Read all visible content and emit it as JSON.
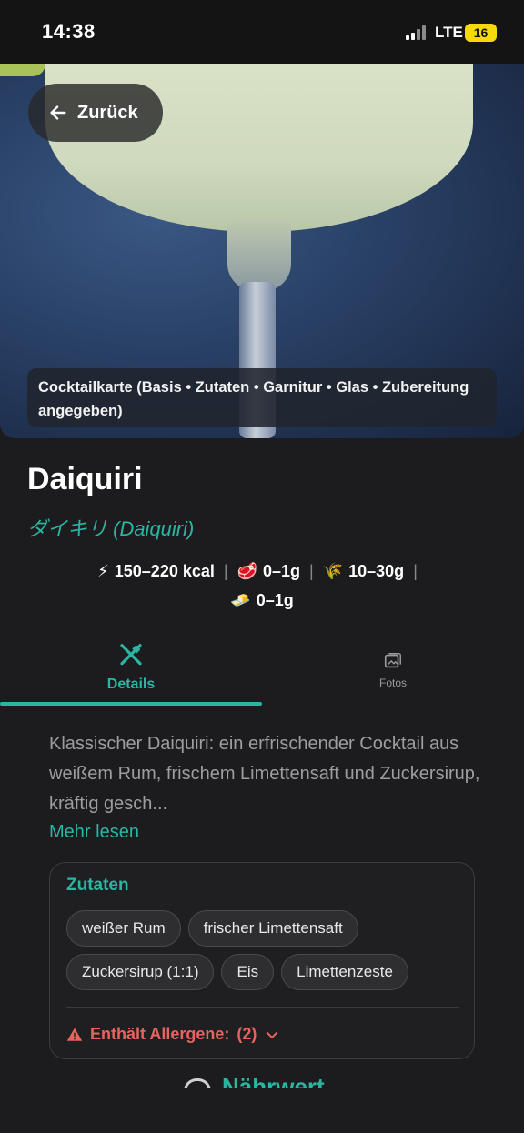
{
  "status": {
    "time": "14:38",
    "network": "LTE",
    "battery": "16"
  },
  "hero": {
    "back_label": "Zurück",
    "caption": "Cocktailkarte (Basis • Zutaten • Garnitur • Glas • Zubereitung angegeben)"
  },
  "drink": {
    "name": "Daiquiri",
    "subtitle": "ダイキリ (Daiquiri)",
    "nutrition": {
      "kcal": "150–220 kcal",
      "protein": "0–1g",
      "carbs": "10–30g",
      "fat": "0–1g"
    }
  },
  "tabs": [
    {
      "label": "Details",
      "icon": "utensils-icon",
      "active": true
    },
    {
      "label": "Fotos",
      "icon": "photo-gallery-icon",
      "active": false
    }
  ],
  "description": "Klassischer Daiquiri: ein erfrischender Cocktail aus weißem Rum, frischem Limettensaft und Zuckersirup, kräftig gesch...",
  "more_label": "Mehr lesen",
  "ingredients": {
    "title": "Zutaten",
    "items": [
      "weißer Rum",
      "frischer Limettensaft",
      "Zuckersirup (1:1)",
      "Eis",
      "Limettenzeste"
    ],
    "allergen_label": "Enthält Allergene:",
    "allergen_count": "(2)"
  },
  "next_section": {
    "title": "Nährwert"
  },
  "colors": {
    "accent": "#2bb5a3",
    "warning": "#e5645f",
    "background": "#1c1c1e"
  }
}
